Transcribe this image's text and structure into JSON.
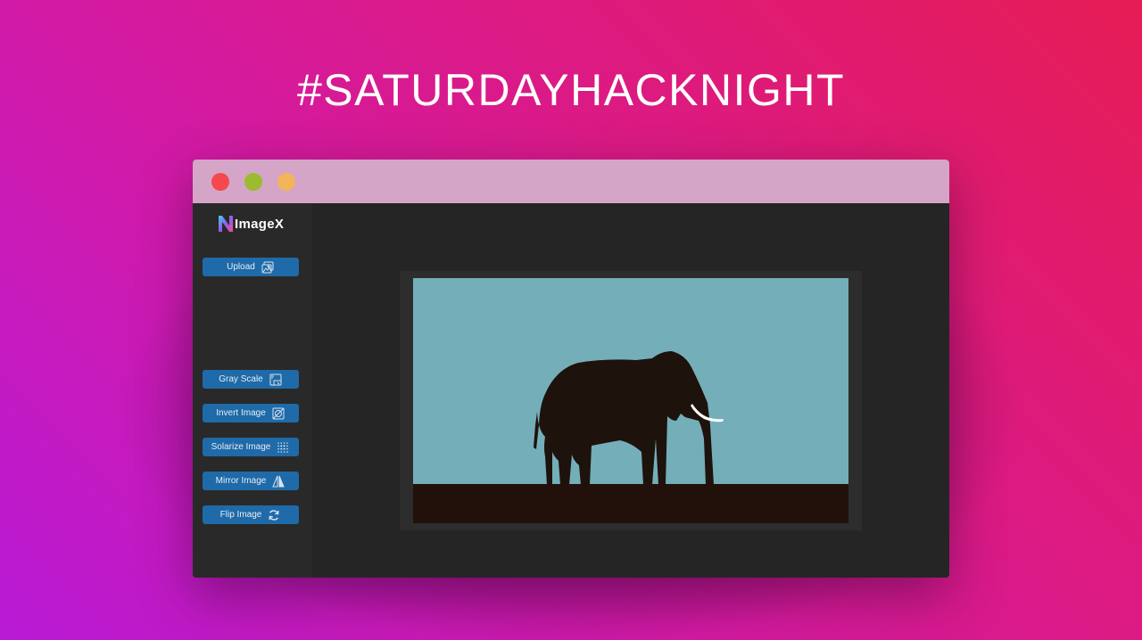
{
  "headline": "#SATURDAYHACKNIGHT",
  "app": {
    "name": "ImageX",
    "logo_icon": "imagex-logo-icon"
  },
  "window_controls": [
    "close",
    "minimize",
    "maximize"
  ],
  "toolbar": {
    "upload": {
      "label": "Upload",
      "icon": "upload-image-icon"
    },
    "actions": [
      {
        "label": "Gray Scale",
        "icon": "grayscale-icon"
      },
      {
        "label": "Invert Image",
        "icon": "invert-icon"
      },
      {
        "label": "Solarize Image",
        "icon": "solarize-icon"
      },
      {
        "label": "Mirror Image",
        "icon": "mirror-icon"
      },
      {
        "label": "Flip Image",
        "icon": "flip-icon"
      }
    ]
  },
  "colors": {
    "button_bg": "#1f6aa8",
    "sky": "#74aeb9",
    "ground": "#21110a",
    "titlebar": "#d4a5c6"
  }
}
